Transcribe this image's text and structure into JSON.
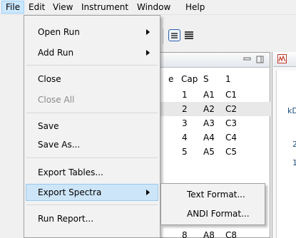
{
  "menubar": {
    "items": [
      "File",
      "Edit",
      "View",
      "Instrument",
      "Window",
      "Help"
    ]
  },
  "file_menu": {
    "open_run": "Open Run",
    "add_run": "Add Run",
    "close": "Close",
    "close_all": "Close All",
    "save": "Save",
    "save_as": "Save As...",
    "export_tables": "Export Tables...",
    "export_spectra": "Export Spectra",
    "run_report": "Run Report..."
  },
  "export_spectra_submenu": {
    "text_format": "Text Format...",
    "andi_format": "ANDI Format..."
  },
  "table": {
    "headers": [
      "e",
      "Cap",
      "S",
      "1"
    ],
    "rows": [
      [
        "1",
        "A1",
        "C1"
      ],
      [
        "2",
        "A2",
        "C2"
      ],
      [
        "3",
        "A3",
        "C3"
      ],
      [
        "4",
        "A4",
        "C4"
      ],
      [
        "5",
        "A5",
        "C5"
      ],
      [
        "8",
        "A8",
        "C8"
      ]
    ]
  },
  "right_panel": {
    "label_kd": "kD",
    "label_2": "2",
    "label_1": "1"
  },
  "colors": {
    "menu_highlight": "#cde5f8",
    "menubar_active": "#cce8ff",
    "disabled_text": "#8a8a8a"
  }
}
